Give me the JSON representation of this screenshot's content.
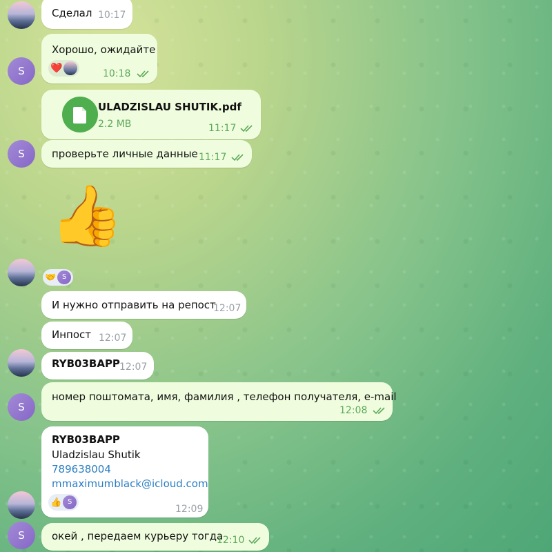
{
  "messages": {
    "m1": {
      "text": "Сделал",
      "time": "10:17"
    },
    "m2": {
      "text": "Хорошо, ожидайте",
      "time": "10:18",
      "reaction": "❤️"
    },
    "m3": {
      "file_name": "ULADZISLAU SHUTIK.pdf",
      "file_size": "2.2 MB",
      "time": "11:17"
    },
    "m4": {
      "text": "проверьте личные данные",
      "time": "11:17"
    },
    "m5": {
      "sticker": "👍"
    },
    "m6": {
      "reaction": "🤝"
    },
    "m7": {
      "text": "И нужно отправить на репост",
      "time": "12:07"
    },
    "m8": {
      "text": "Инпост",
      "time": "12:07"
    },
    "m9": {
      "text": "RYB03BAPP",
      "time": "12:07"
    },
    "m10": {
      "text": "номер поштомата, имя, фамилия , телефон получателя, e-mail",
      "time": "12:08"
    },
    "m11": {
      "line1": "RYB03BAPP",
      "line2": "Uladzislau Shutik",
      "line3": "789638004",
      "line4": "mmaximumblack@icloud.com",
      "time": "12:09",
      "reaction": "👍"
    },
    "m12": {
      "text": "окей , передаем курьеру тогда",
      "time": "12:10"
    }
  },
  "avatar_letter": "S",
  "colors": {
    "incoming": "#ffffff",
    "outgoing": "#effdde",
    "time_out": "#5ea85a",
    "link": "#2a7ec2",
    "file_icon": "#4fae4e"
  }
}
